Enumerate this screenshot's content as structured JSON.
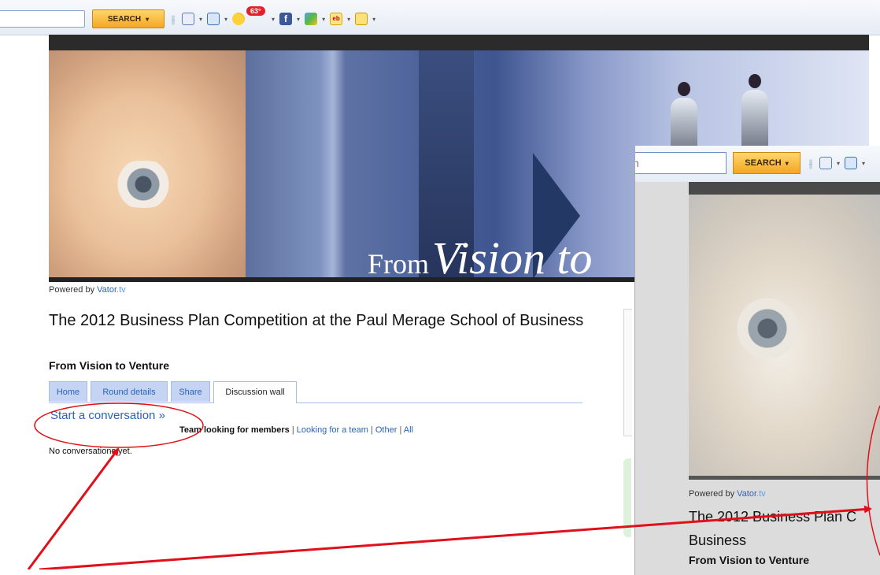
{
  "toolbar": {
    "search_label": "SEARCH",
    "dropdown_glyph": "▾",
    "weather_badge": "63°",
    "icons": [
      "divider-icon",
      "document-icon",
      "mail-icon",
      "weather-icon",
      "facebook-icon",
      "photo-icon",
      "ebay-icon",
      "notes-icon"
    ],
    "fb_glyph": "f",
    "ebay_glyph": "eb"
  },
  "banner": {
    "from_text": "From",
    "vision_text": "Vision to"
  },
  "page": {
    "powered_prefix": "Powered by ",
    "powered_brand": "Vator",
    "powered_suffix": ".tv",
    "title": "The 2012 Business Plan Competition at the Paul Merage School of Business",
    "subtitle": "From Vision to Venture",
    "tabs": [
      {
        "label": "Home",
        "active": false
      },
      {
        "label": "Round details",
        "active": false
      },
      {
        "label": "Share",
        "active": false
      },
      {
        "label": "Discussion wall",
        "active": true
      }
    ],
    "start_conversation": "Start a conversation »",
    "filters": {
      "active": "Team looking for members",
      "sep": "|",
      "links": [
        "Looking for a team",
        "Other",
        "All"
      ]
    },
    "empty_message": "No conversations yet."
  },
  "zoomed": {
    "input_text": "n",
    "search_label": "SEARCH",
    "powered_prefix": "Powered by ",
    "powered_brand": "Vator",
    "powered_suffix": ".tv",
    "title_line1": "The 2012 Business Plan C",
    "title_line2": "Business",
    "subtitle": "From Vision to Venture"
  },
  "annotation_colors": {
    "red": "#e0101a"
  }
}
